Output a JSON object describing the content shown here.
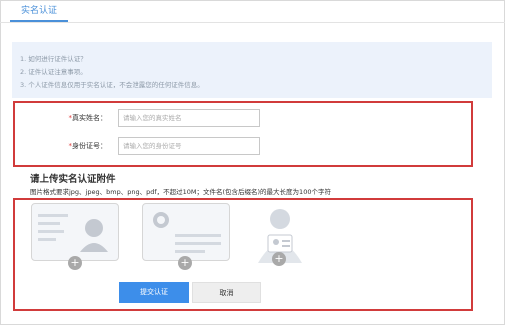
{
  "tabs": {
    "active_label": "实名认证"
  },
  "info": {
    "lines": [
      "1. 如何进行证件认证？",
      "2. 证件认证注意事项。",
      "3. 个人证件信息仅用于实名认证，不会泄露您的任何证件信息。"
    ]
  },
  "form": {
    "name_label": "真实姓名：",
    "name_placeholder": "请输入您的真实姓名",
    "id_label": "身份证号：",
    "id_placeholder": "请输入您的身份证号",
    "required_mark": "*"
  },
  "upload": {
    "title": "请上传实名认证附件",
    "hint": "图片格式要求jpg、jpeg、bmp、png、pdf，不超过10M；文件名(包含后缀名)的最大长度为100个字符",
    "plus": "+"
  },
  "actions": {
    "submit_label": "提交认证",
    "cancel_label": "取消"
  },
  "colors": {
    "accent": "#3d8eea",
    "highlight_border": "#d13b3b",
    "info_bg": "#ecf2fb"
  }
}
